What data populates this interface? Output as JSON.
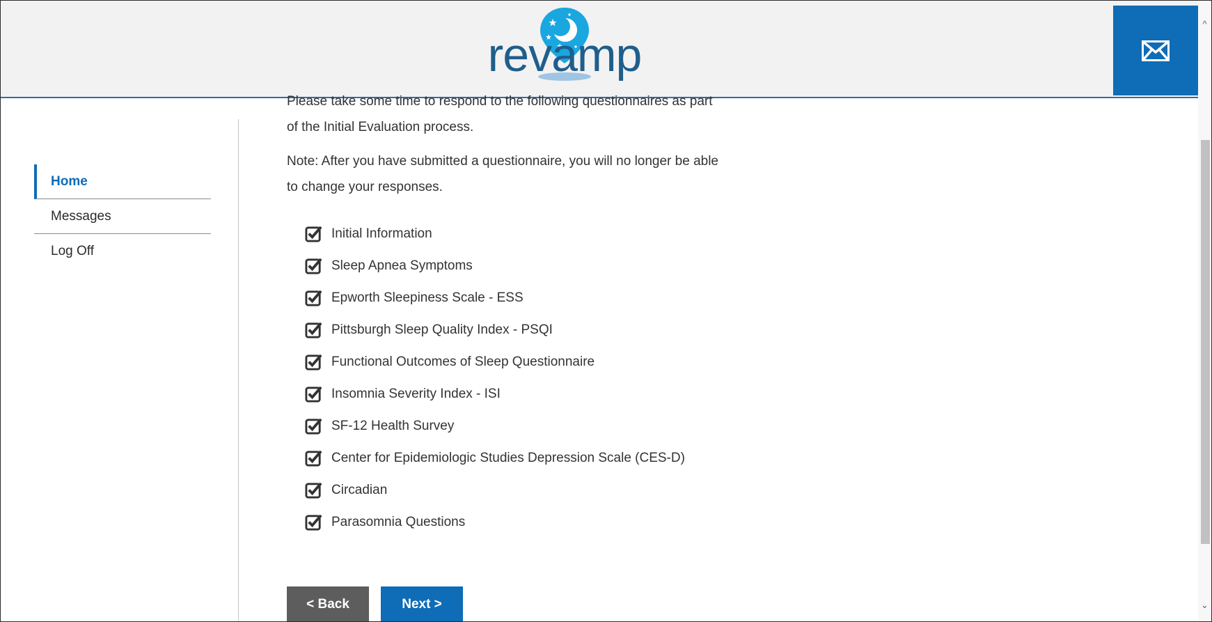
{
  "header": {
    "logo_text": "revamp",
    "mail_icon": "envelope-icon",
    "accent_color": "#0f6cb6"
  },
  "sidebar": {
    "items": [
      {
        "label": "Home",
        "active": true
      },
      {
        "label": "Messages",
        "active": false
      },
      {
        "label": "Log Off",
        "active": false
      }
    ]
  },
  "main": {
    "intro_line1": "Please take some time to respond to the following questionnaires as part",
    "intro_line2": "of the Initial Evaluation process.",
    "note_line1": "Note: After you have submitted a questionnaire, you will no longer be able",
    "note_line2": "to change your responses.",
    "questionnaires": [
      {
        "label": "Initial Information",
        "completed": true
      },
      {
        "label": "Sleep Apnea Symptoms",
        "completed": true
      },
      {
        "label": "Epworth Sleepiness Scale - ESS",
        "completed": true
      },
      {
        "label": "Pittsburgh Sleep Quality Index - PSQI",
        "completed": true
      },
      {
        "label": "Functional Outcomes of Sleep Questionnaire",
        "completed": true
      },
      {
        "label": "Insomnia Severity Index - ISI",
        "completed": true
      },
      {
        "label": "SF-12 Health Survey",
        "completed": true
      },
      {
        "label": "Center for Epidemiologic Studies Depression Scale (CES-D)",
        "completed": true
      },
      {
        "label": "Circadian",
        "completed": true
      },
      {
        "label": "Parasomnia Questions",
        "completed": true
      }
    ]
  },
  "buttons": {
    "back_label": "< Back",
    "next_label": "Next >"
  }
}
